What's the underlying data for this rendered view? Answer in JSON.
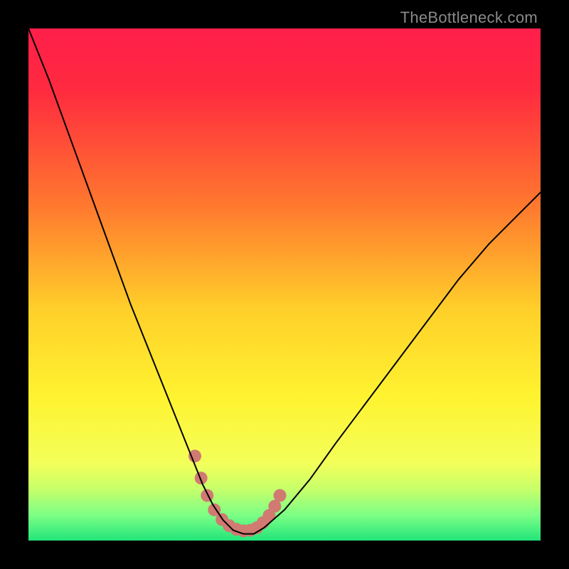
{
  "watermark": "TheBottleneck.com",
  "chart_data": {
    "type": "line",
    "title": "",
    "xlabel": "",
    "ylabel": "",
    "legend": false,
    "xlim": [
      0,
      100
    ],
    "ylim": [
      0,
      100
    ],
    "background": {
      "type": "vertical-gradient",
      "description": "Red at top through orange, yellow, to green at bottom; topmost band slightly pink-red",
      "stops": [
        {
          "pos": 0.0,
          "color": "#ff1f4b"
        },
        {
          "pos": 0.12,
          "color": "#ff2a3f"
        },
        {
          "pos": 0.35,
          "color": "#ff7a2e"
        },
        {
          "pos": 0.55,
          "color": "#ffd02a"
        },
        {
          "pos": 0.72,
          "color": "#fff330"
        },
        {
          "pos": 0.85,
          "color": "#f3ff5a"
        },
        {
          "pos": 0.9,
          "color": "#c6ff6a"
        },
        {
          "pos": 0.95,
          "color": "#7dff86"
        },
        {
          "pos": 1.0,
          "color": "#22e57a"
        }
      ]
    },
    "series": [
      {
        "name": "bottleneck-curve",
        "color": "#000000",
        "width": 2,
        "x": [
          0,
          4,
          8,
          12,
          16,
          20,
          24,
          28,
          32,
          34,
          36,
          38,
          40,
          42,
          44,
          46,
          50,
          55,
          60,
          66,
          72,
          78,
          84,
          90,
          96,
          100
        ],
        "y": [
          100,
          90,
          79,
          68,
          57,
          46,
          36,
          26,
          16,
          11,
          7,
          4,
          2,
          1.3,
          1.3,
          2.5,
          6,
          12,
          19,
          27,
          35,
          43,
          51,
          58,
          64,
          68
        ]
      }
    ],
    "highlight": {
      "name": "minimum-region",
      "description": "Salmon-colored rounded markers across the valley floor of the curve",
      "color": "#d07a72",
      "points_xy": [
        [
          32.5,
          16.5
        ],
        [
          33.7,
          12.2
        ],
        [
          34.9,
          8.8
        ],
        [
          36.3,
          6.0
        ],
        [
          37.8,
          4.1
        ],
        [
          39.2,
          2.9
        ],
        [
          40.6,
          2.2
        ],
        [
          42.0,
          1.9
        ],
        [
          43.3,
          2.0
        ],
        [
          44.6,
          2.5
        ],
        [
          45.8,
          3.5
        ],
        [
          47.0,
          4.9
        ],
        [
          48.1,
          6.7
        ],
        [
          49.1,
          8.8
        ]
      ],
      "radius": 9
    }
  }
}
